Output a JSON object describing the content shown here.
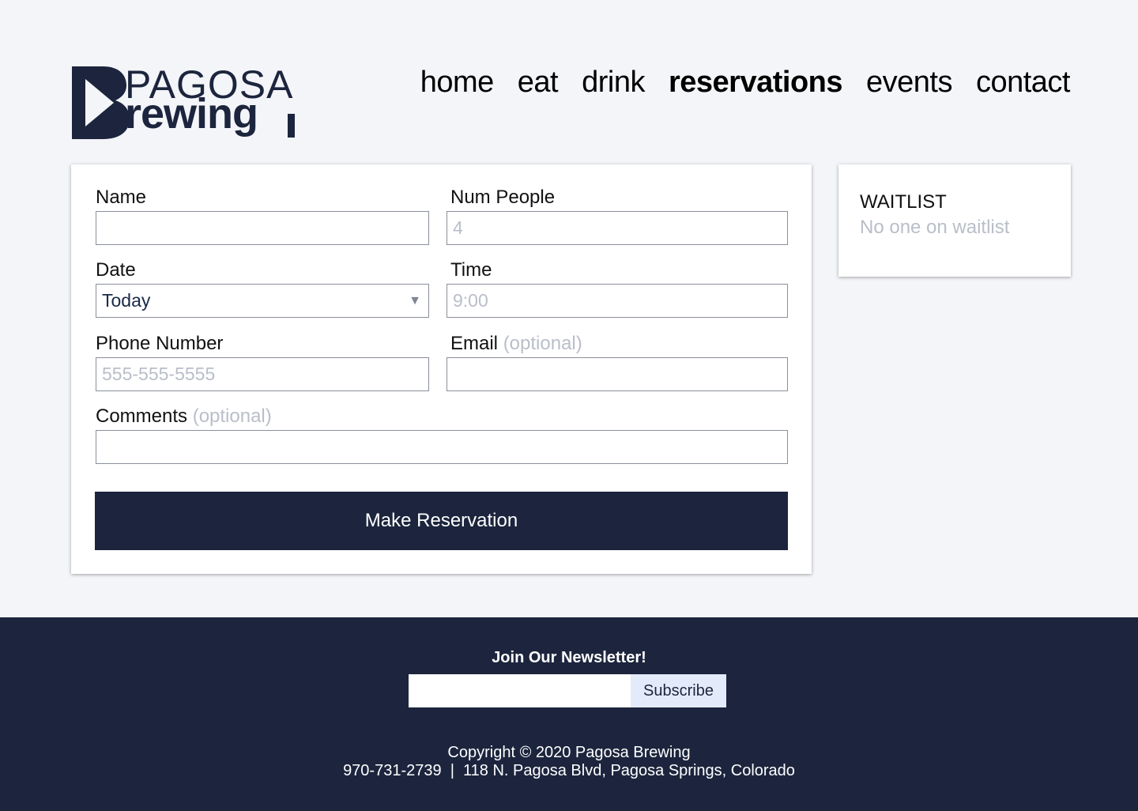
{
  "brand": {
    "logo_top": "PAGOSA",
    "logo_bottom": "rewing",
    "logo_initial": "B",
    "colors": {
      "navy": "#1c253d",
      "background": "#f4f5f9",
      "muted": "#b9bec9",
      "subscribe_bg": "#e3ebfa"
    }
  },
  "nav": {
    "items": [
      {
        "label": "home",
        "active": false
      },
      {
        "label": "eat",
        "active": false
      },
      {
        "label": "drink",
        "active": false
      },
      {
        "label": "reservations",
        "active": true
      },
      {
        "label": "events",
        "active": false
      },
      {
        "label": "contact",
        "active": false
      }
    ]
  },
  "form": {
    "name": {
      "label": "Name",
      "value": "",
      "placeholder": ""
    },
    "num_people": {
      "label": "Num People",
      "value": "",
      "placeholder": "4"
    },
    "date": {
      "label": "Date",
      "value": "Today",
      "icon": "caret-down-icon"
    },
    "time": {
      "label": "Time",
      "value": "",
      "placeholder": "9:00"
    },
    "phone": {
      "label": "Phone Number",
      "value": "",
      "placeholder": "555-555-5555"
    },
    "email": {
      "label": "Email",
      "optional": "(optional)",
      "value": "",
      "placeholder": ""
    },
    "comments": {
      "label": "Comments",
      "optional": "(optional)",
      "value": "",
      "placeholder": ""
    },
    "submit_label": "Make Reservation"
  },
  "waitlist": {
    "title": "WAITLIST",
    "empty_text": "No one on waitlist"
  },
  "footer": {
    "newsletter_title": "Join Our Newsletter!",
    "newsletter_placeholder": "",
    "subscribe_label": "Subscribe",
    "copyright": "Copyright © 2020 Pagosa Brewing",
    "address": "970-731-2739  |  118 N. Pagosa Blvd, Pagosa Springs, Colorado"
  }
}
